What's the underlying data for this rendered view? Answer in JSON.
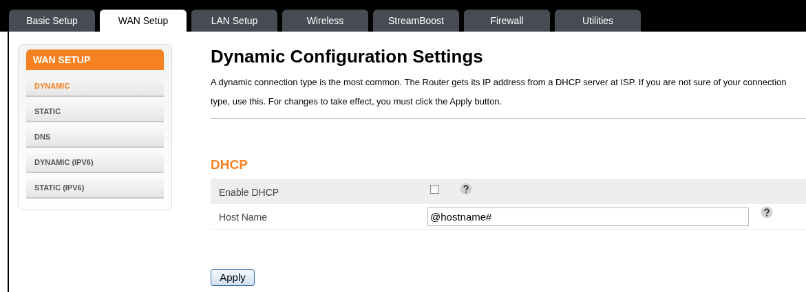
{
  "tabs": [
    {
      "label": "Basic Setup",
      "selected": false
    },
    {
      "label": "WAN Setup",
      "selected": true
    },
    {
      "label": "LAN Setup",
      "selected": false
    },
    {
      "label": "Wireless",
      "selected": false
    },
    {
      "label": "StreamBoost",
      "selected": false
    },
    {
      "label": "Firewall",
      "selected": false
    },
    {
      "label": "Utilities",
      "selected": false
    }
  ],
  "sidebar": {
    "title": "WAN SETUP",
    "items": [
      {
        "label": "DYNAMIC",
        "selected": true
      },
      {
        "label": "STATIC",
        "selected": false
      },
      {
        "label": "DNS",
        "selected": false
      },
      {
        "label": "DYNAMIC (IPV6)",
        "selected": false
      },
      {
        "label": "STATIC (IPV6)",
        "selected": false
      }
    ]
  },
  "page": {
    "title": "Dynamic Configuration Settings",
    "description": "A dynamic connection type is the most common. The Router gets its IP address from a DHCP server at ISP. If you are not sure of your connection type, use this. For changes to take effect, you must click the Apply button."
  },
  "section": {
    "title": "DHCP",
    "rows": [
      {
        "kind": "checkbox",
        "label": "Enable DHCP",
        "checked": false
      },
      {
        "kind": "text",
        "label": "Host Name",
        "value": "@hostname#"
      }
    ]
  },
  "apply_button": "Apply"
}
